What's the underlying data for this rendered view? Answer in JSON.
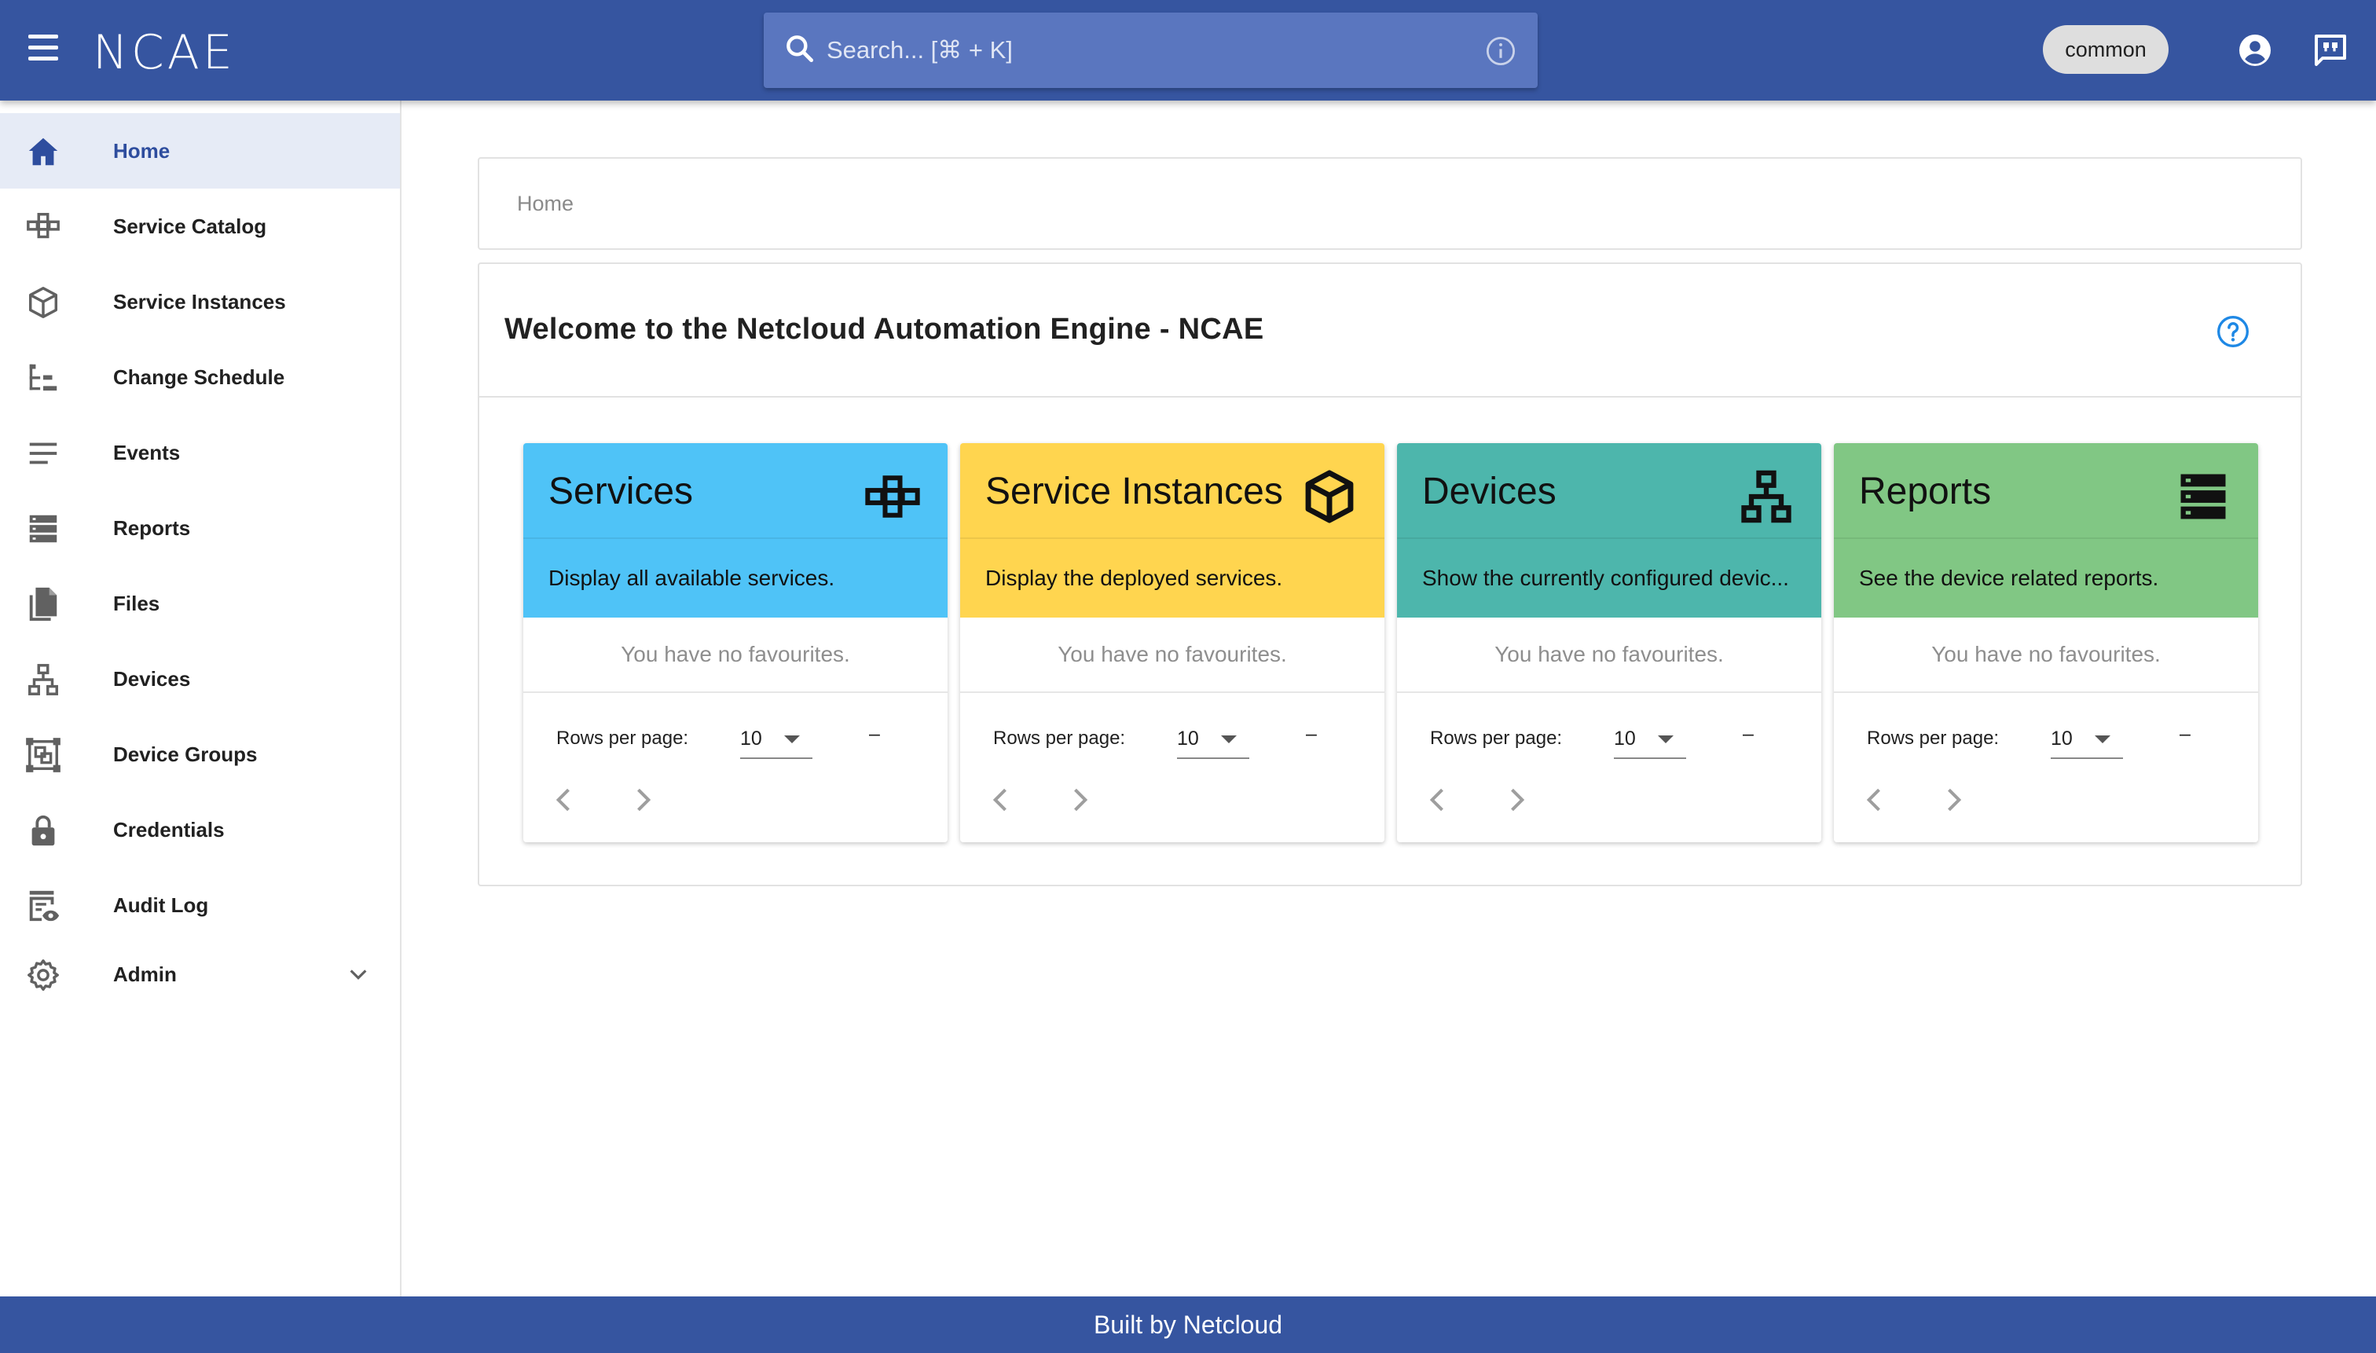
{
  "header": {
    "logo": "NCAE",
    "search_placeholder": "Search... [⌘ + K]",
    "scope_chip": "common"
  },
  "sidebar": {
    "items": [
      {
        "label": "Home",
        "icon": "home-icon",
        "active": true
      },
      {
        "label": "Service Catalog",
        "icon": "service-catalog-icon"
      },
      {
        "label": "Service Instances",
        "icon": "cube-icon"
      },
      {
        "label": "Change Schedule",
        "icon": "schedule-tree-icon"
      },
      {
        "label": "Events",
        "icon": "events-list-icon"
      },
      {
        "label": "Reports",
        "icon": "reports-icon"
      },
      {
        "label": "Files",
        "icon": "files-icon"
      },
      {
        "label": "Devices",
        "icon": "devices-network-icon"
      },
      {
        "label": "Device Groups",
        "icon": "device-groups-icon"
      },
      {
        "label": "Credentials",
        "icon": "lock-icon"
      },
      {
        "label": "Audit Log",
        "icon": "audit-log-icon"
      },
      {
        "label": "Admin",
        "icon": "gear-icon",
        "expandable": true
      }
    ]
  },
  "breadcrumb": {
    "current": "Home"
  },
  "welcome": {
    "title": "Welcome to the Netcloud Automation Engine - NCAE"
  },
  "cards": [
    {
      "title": "Services",
      "description": "Display all available services.",
      "color": "#4fc3f7",
      "icon": "services-blocks-icon",
      "empty_text": "You have no favourites.",
      "rows_label": "Rows per page:",
      "rows_value": "10",
      "range": "–"
    },
    {
      "title": "Service Instances",
      "description": "Display the deployed services.",
      "color": "#ffd54f",
      "icon": "cube-icon",
      "empty_text": "You have no favourites.",
      "rows_label": "Rows per page:",
      "rows_value": "10",
      "range": "–"
    },
    {
      "title": "Devices",
      "description": "Show the currently configured devic...",
      "color": "#4db6ac",
      "icon": "devices-network-icon",
      "empty_text": "You have no favourites.",
      "rows_label": "Rows per page:",
      "rows_value": "10",
      "range": "–"
    },
    {
      "title": "Reports",
      "description": "See the device related reports.",
      "color": "#81c784",
      "icon": "reports-icon",
      "empty_text": "You have no favourites.",
      "rows_label": "Rows per page:",
      "rows_value": "10",
      "range": "–"
    }
  ],
  "footer": {
    "text": "Built by Netcloud"
  },
  "colors": {
    "brand": "#3655a0",
    "search_bg": "#5a76bf",
    "active_nav_bg": "#e6ebf6"
  }
}
